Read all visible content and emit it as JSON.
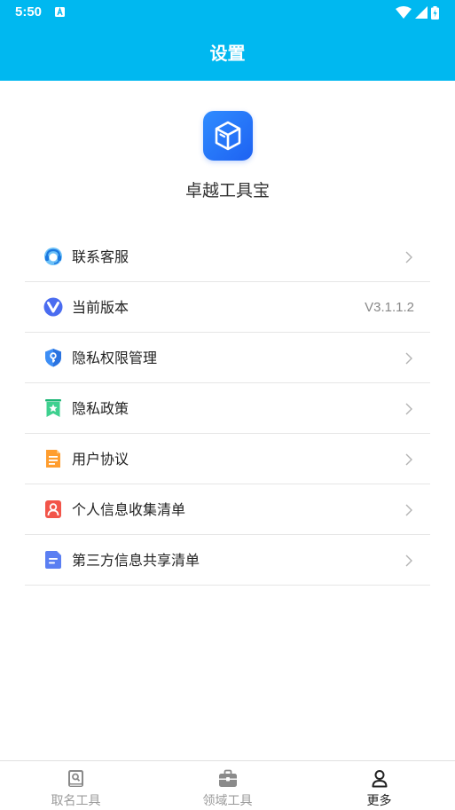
{
  "status_bar": {
    "time": "5:50"
  },
  "header": {
    "title": "设置"
  },
  "app": {
    "name": "卓越工具宝",
    "logo_icon": "cube-icon",
    "brand_color": "#00b8f0"
  },
  "menu": {
    "items": [
      {
        "label": "联系客服",
        "icon": "customer-service-icon"
      },
      {
        "label": "当前版本",
        "icon": "version-icon",
        "value": "V3.1.1.2"
      },
      {
        "label": "隐私权限管理",
        "icon": "shield-key-icon"
      },
      {
        "label": "隐私政策",
        "icon": "bookmark-star-icon"
      },
      {
        "label": "用户协议",
        "icon": "document-icon"
      },
      {
        "label": "个人信息收集清单",
        "icon": "person-card-icon"
      },
      {
        "label": "第三方信息共享清单",
        "icon": "file-lines-icon"
      }
    ]
  },
  "bottom_nav": {
    "items": [
      {
        "label": "取名工具",
        "icon": "book-search-icon",
        "active": false
      },
      {
        "label": "领域工具",
        "icon": "briefcase-icon",
        "active": false
      },
      {
        "label": "更多",
        "icon": "person-icon",
        "active": true
      }
    ]
  }
}
